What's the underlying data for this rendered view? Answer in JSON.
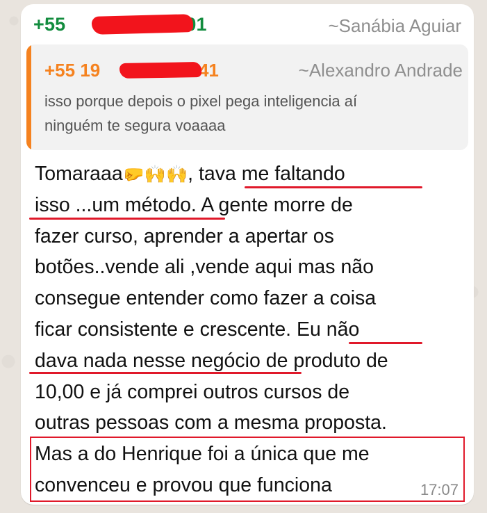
{
  "message": {
    "sender_phone_prefix": "+55 ",
    "sender_phone_suffix": "001",
    "sender_name": "~Sanábia Aguiar",
    "timestamp": "17:07"
  },
  "quoted": {
    "phone_prefix": "+55 19 ",
    "phone_suffix": "941",
    "name": "~Alexandro Andrade",
    "text_line1": "isso porque depois o pixel pega inteligencia aí",
    "text_line2": "ninguém te segura voaaaa"
  },
  "body": {
    "l1_a": "Tomaraaa",
    "l1_emoji": "🤛🙌🙌",
    "l1_b": ", tava me faltando",
    "l2": "isso ...um método. A gente morre de",
    "l3": "fazer curso, aprender a apertar os",
    "l4": "botões..vende ali ,vende aqui mas não",
    "l5": "consegue entender como fazer a coisa",
    "l6": "ficar consistente e crescente. Eu não",
    "l7": "dava nada nesse negócio de produto de",
    "l8": "10,00 e já comprei outros cursos de",
    "l9": "outras pessoas com a mesma proposta.",
    "l10": "Mas a do Henrique foi a única que me",
    "l11": "convenceu e provou que funciona"
  },
  "colors": {
    "sender_green": "#128c3e",
    "quote_orange": "#f5821f",
    "annotation_red": "#e0192a"
  }
}
